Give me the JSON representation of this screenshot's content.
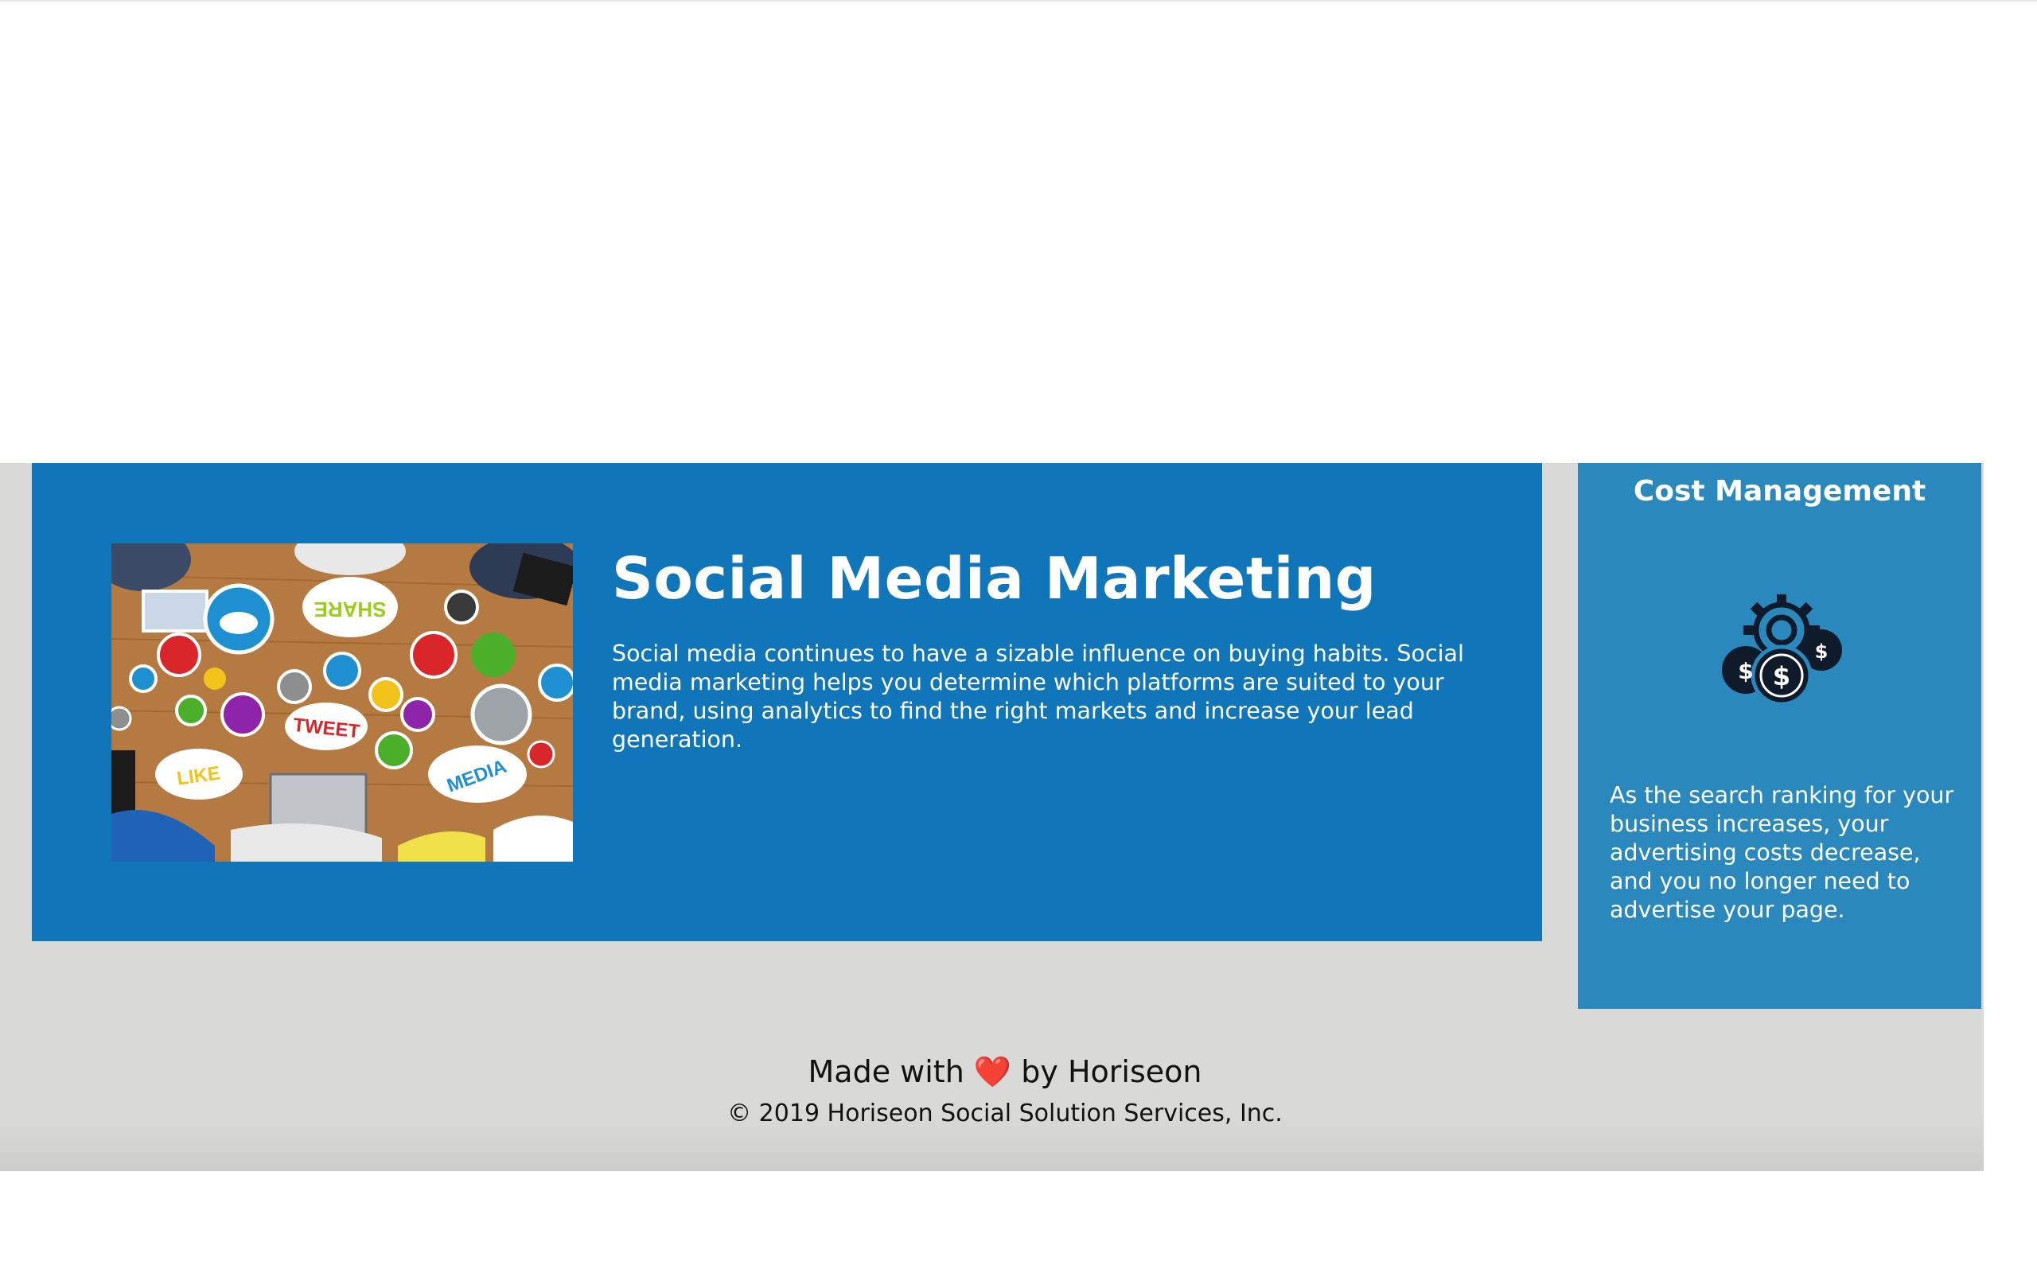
{
  "social_media_marketing": {
    "title": "Social Media Marketing",
    "description": "Social media continues to have a sizable influence on buying habits. Social media marketing helps you determine which platforms are suited to your brand, using analytics to find the right markets and increase your lead generation.",
    "image_labels": {
      "share": "SHARE",
      "tweet": "TWEET",
      "like": "LIKE",
      "media": "MEDIA"
    }
  },
  "cost_management": {
    "title": "Cost Management",
    "icon": "cost-management-icon",
    "description": "As the search ranking for your business increases, your advertising costs decrease, and you no longer need to advertise your page."
  },
  "footer": {
    "made_prefix": "Made with",
    "heart": "❤️",
    "made_suffix": "by Horiseon",
    "copyright": "© 2019 Horiseon Social Solution Services, Inc."
  },
  "colors": {
    "page_background": "#d9dad7",
    "smm_panel": "#1176b9",
    "cost_panel": "#2b88bc",
    "text_light": "#ffffff",
    "heart": "#e3141d"
  }
}
